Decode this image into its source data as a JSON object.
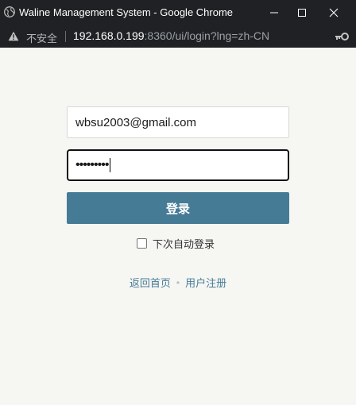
{
  "browser": {
    "window_title": "Waline Management System - Google Chrome",
    "security_label": "不安全",
    "url_host": "192.168.0.199",
    "url_rest": ":8360/ui/login?lng=zh-CN"
  },
  "login": {
    "email_value": "wbsu2003@gmail.com",
    "password_masked": "•••••••••",
    "submit_label": "登录",
    "remember_label": "下次自动登录",
    "remember_checked": false
  },
  "footer_links": {
    "home_label": "返回首页",
    "separator": "•",
    "register_label": "用户注册"
  },
  "colors": {
    "accent": "#467b96",
    "page_background": "#f6f6f3",
    "chrome_dark": "#202124"
  }
}
